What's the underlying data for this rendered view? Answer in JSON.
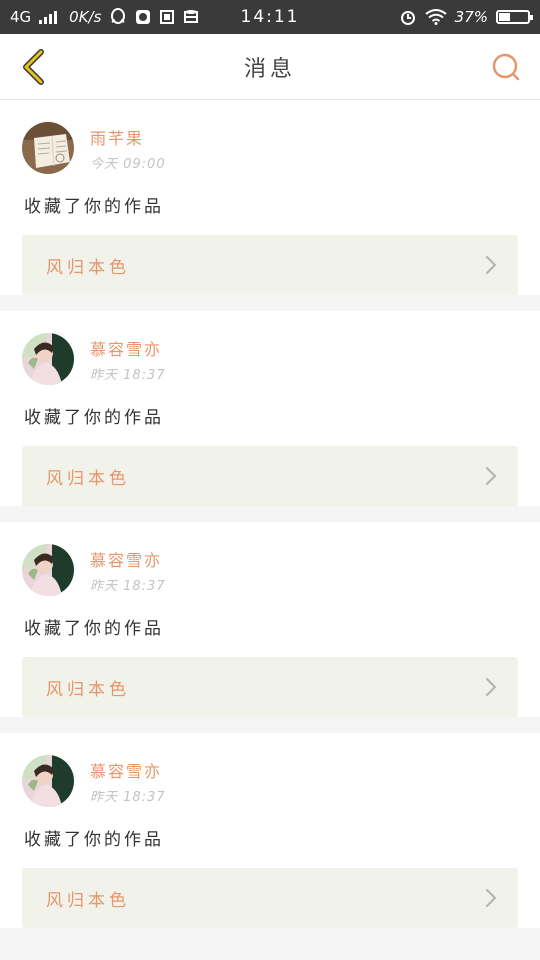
{
  "status_bar": {
    "network": "4G",
    "speed": "0K/s",
    "time": "14:11",
    "battery": "37%"
  },
  "header": {
    "title": "消息"
  },
  "colors": {
    "accent": "#e8956a",
    "back_icon": "#e8c21c",
    "card_link_bg": "#f1f2e9"
  },
  "messages": [
    {
      "username": "雨芊果",
      "time": "今天 09:00",
      "action": "收藏了你的作品",
      "work_title": "风归本色",
      "avatar": "book-photo"
    },
    {
      "username": "慕容雪亦",
      "time": "昨天 18:37",
      "action": "收藏了你的作品",
      "work_title": "风归本色",
      "avatar": "girl-photo"
    },
    {
      "username": "慕容雪亦",
      "time": "昨天 18:37",
      "action": "收藏了你的作品",
      "work_title": "风归本色",
      "avatar": "girl-photo"
    },
    {
      "username": "慕容雪亦",
      "time": "昨天 18:37",
      "action": "收藏了你的作品",
      "work_title": "风归本色",
      "avatar": "girl-photo"
    }
  ]
}
